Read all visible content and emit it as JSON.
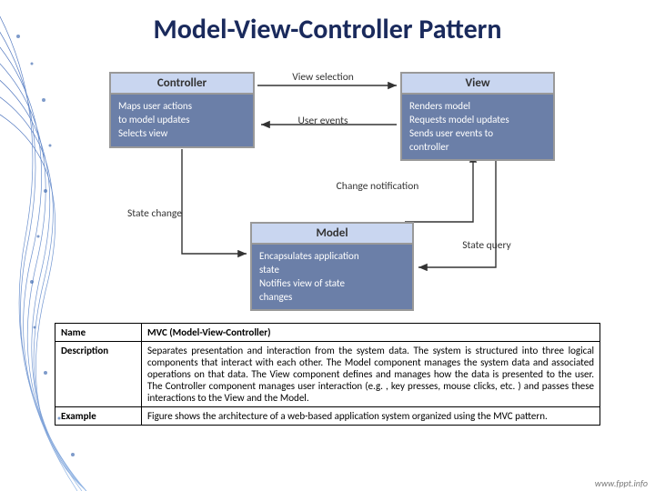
{
  "title": "Model-View-Controller Pattern",
  "diagram": {
    "controller": {
      "head": "Controller",
      "body": "Maps user actions\nto model updates\nSelects view"
    },
    "view": {
      "head": "View",
      "body": "Renders model\nRequests model updates\nSends user events to\ncontroller"
    },
    "model": {
      "head": "Model",
      "body": "Encapsulates application\nstate\nNotifies view of state\nchanges"
    },
    "labels": {
      "view_selection": "View\nselection",
      "user_events": "User events",
      "change_notification": "Change\nnotification",
      "state_change": "State\nchange",
      "state_query": "State query"
    }
  },
  "table": {
    "rows": [
      {
        "key": "Name",
        "value": "MVC (Model-View-Controller)"
      },
      {
        "key": "Description",
        "value": "Separates presentation and interaction from the system data. The system is structured into three logical components that interact with each other. The Model component manages the system data and associated operations on that data. The View component defines and manages how the data is presented to the user. The Controller component manages user interaction (e.g. , key presses, mouse clicks, etc. ) and passes these interactions to the View and the Model."
      },
      {
        "key": "Example",
        "value": "Figure shows the architecture of a web-based application system organized using the MVC pattern."
      }
    ]
  },
  "footer": "www.fppt.info"
}
